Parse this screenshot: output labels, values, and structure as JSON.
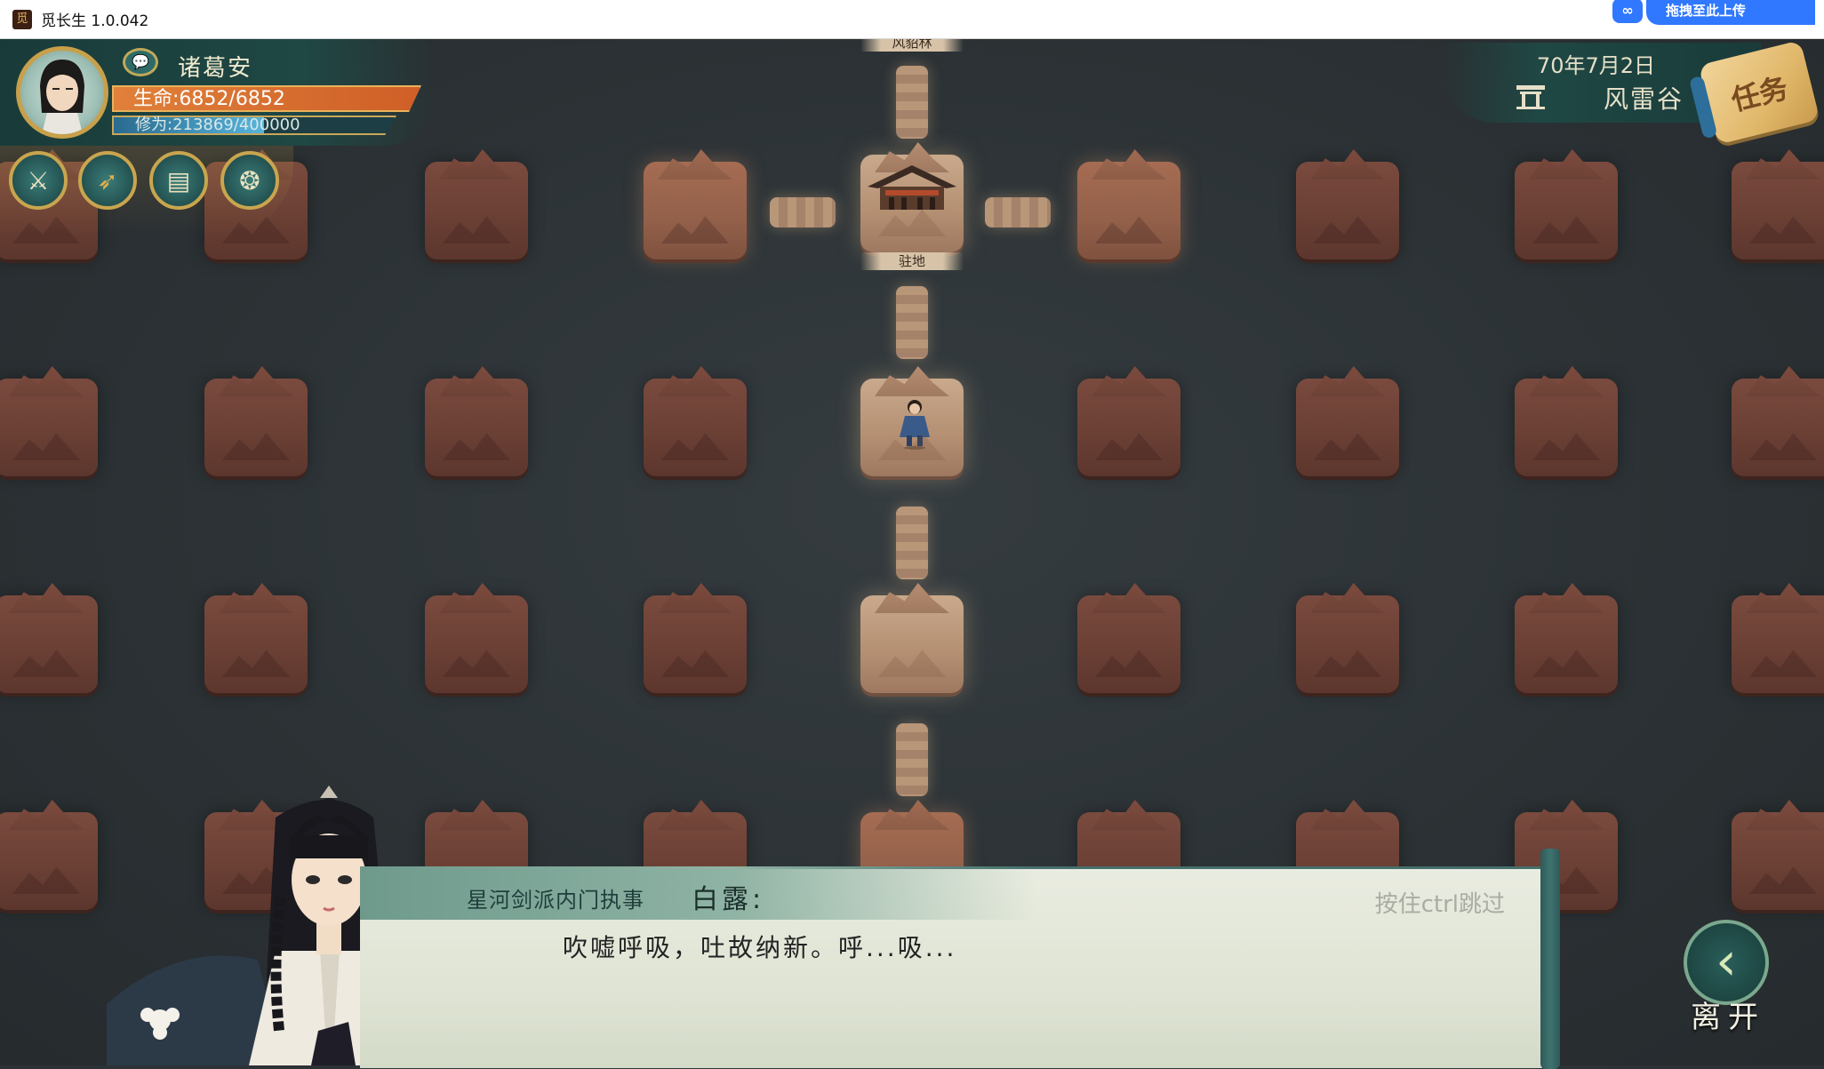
{
  "window": {
    "title": "觅长生 1.0.042",
    "app_icon": "app-icon"
  },
  "overlay_badge": {
    "label": "拖拽至此上传",
    "icon": "baidu-netdisk-icon"
  },
  "player": {
    "name": "诸葛安",
    "hp_label": "生命:",
    "hp_value": "6852/6852",
    "hp_fraction": 1.0,
    "cultivation_label": "修为:",
    "cultivation_value": "213869/400000",
    "cultivation_fraction": 0.535
  },
  "skills": [
    {
      "name": "sword-icon"
    },
    {
      "name": "feather-icon"
    },
    {
      "name": "map-scroll-icon"
    },
    {
      "name": "rune-scroll-icon"
    }
  ],
  "status": {
    "date": "70年7月2日",
    "location": "风雷谷",
    "task_button": "任务"
  },
  "map": {
    "top_label": "风貂林",
    "base_label": "驻地"
  },
  "dialog": {
    "speaker_title": "星河剑派内门执事",
    "speaker_name": "白露:",
    "text": "吹嘘呼吸，吐故纳新。呼...吸...",
    "skip_hint": "按住ctrl跳过"
  },
  "leave_button": {
    "label": "离开"
  },
  "colors": {
    "hp": "#d9742d",
    "cultivation": "#56b4dd",
    "hud_teal": "#1e4a46",
    "gold_trim": "#c9a54e"
  }
}
